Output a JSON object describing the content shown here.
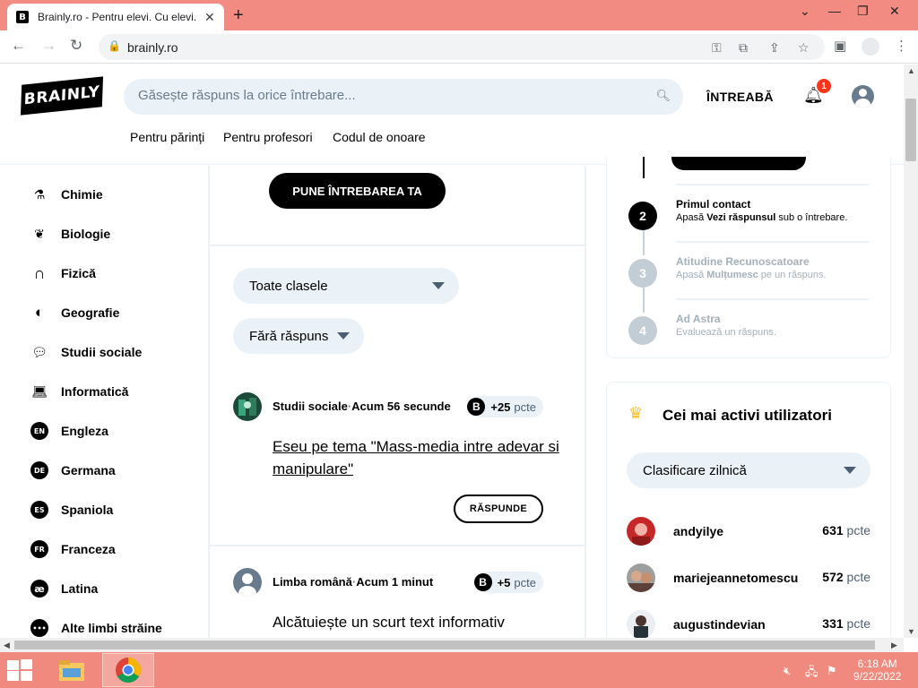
{
  "browser": {
    "tab_title": "Brainly.ro - Pentru elevi. Cu elevi.",
    "favicon": "B",
    "url": "brainly.ro"
  },
  "header": {
    "logo": "BRAINLY",
    "search_placeholder": "Găsește răspuns la orice întrebare...",
    "ask_label": "ÎNTREABĂ",
    "notification_count": "1",
    "links": [
      "Pentru părinți",
      "Pentru profesori",
      "Codul de onoare"
    ]
  },
  "sidebar": {
    "items": [
      {
        "label": "Chimie",
        "icon": "flask-icon"
      },
      {
        "label": "Biologie",
        "icon": "leaf-icon"
      },
      {
        "label": "Fizică",
        "icon": "magnet-icon"
      },
      {
        "label": "Geografie",
        "icon": "globe-icon"
      },
      {
        "label": "Studii sociale",
        "icon": "people-icon"
      },
      {
        "label": "Informatică",
        "icon": "laptop-icon"
      },
      {
        "label": "Engleza",
        "icon": "en-icon",
        "badge": "EN"
      },
      {
        "label": "Germana",
        "icon": "de-icon",
        "badge": "DE"
      },
      {
        "label": "Spaniola",
        "icon": "es-icon",
        "badge": "ES"
      },
      {
        "label": "Franceza",
        "icon": "fr-icon",
        "badge": "FR"
      },
      {
        "label": "Latina",
        "icon": "latin-icon",
        "badge": "æ"
      },
      {
        "label": "Alte limbi străine",
        "icon": "chat-icon",
        "badge": "•••"
      }
    ]
  },
  "feed": {
    "ask_button": "PUNE ÎNTREBAREA TA",
    "filter_class": "Toate clasele",
    "filter_status": "Fără răspuns",
    "questions": [
      {
        "subject": "Studii sociale",
        "sep": "·",
        "time": "Acum 56 secunde",
        "points": "+25",
        "points_unit": "pcte",
        "text": "Eseu pe tema \"Mass-media intre adevar si manipulare\"",
        "answer_label": "RĂSPUNDE"
      },
      {
        "subject": "Limba română",
        "sep": "·",
        "time": "Acum 1 minut",
        "points": "+5",
        "points_unit": "pcte",
        "text": "Alcătuiește un scurt text informativ"
      }
    ],
    "points_badge": "B"
  },
  "onboarding": {
    "steps": [
      {
        "num": "2",
        "title": "Primul contact",
        "desc_pre": "Apasă ",
        "desc_bold": "Vezi răspunsul",
        "desc_post": " sub o întrebare.",
        "active": true
      },
      {
        "num": "3",
        "title": "Atitudine Recunoscatoare",
        "desc_pre": "Apasă ",
        "desc_bold": "Mulțumesc",
        "desc_post": " pe un răspuns.",
        "active": false
      },
      {
        "num": "4",
        "title": "Ad Astra",
        "desc_pre": "Evaluează un răspuns.",
        "desc_bold": "",
        "desc_post": "",
        "active": false
      }
    ]
  },
  "leaders": {
    "title": "Cei mai activi utilizatori",
    "filter": "Clasificare zilnică",
    "unit": "pcte",
    "users": [
      {
        "name": "andyilye",
        "points": "631"
      },
      {
        "name": "mariejeannetomescu",
        "points": "572"
      },
      {
        "name": "augustindevian",
        "points": "331"
      }
    ]
  },
  "taskbar": {
    "time": "6:18 AM",
    "date": "9/22/2022"
  },
  "colors": {
    "titlebar": "#f28b82",
    "taskbar": "#f08a7e",
    "light_bg": "#ebf2f7",
    "accent_red": "#ff341a"
  }
}
